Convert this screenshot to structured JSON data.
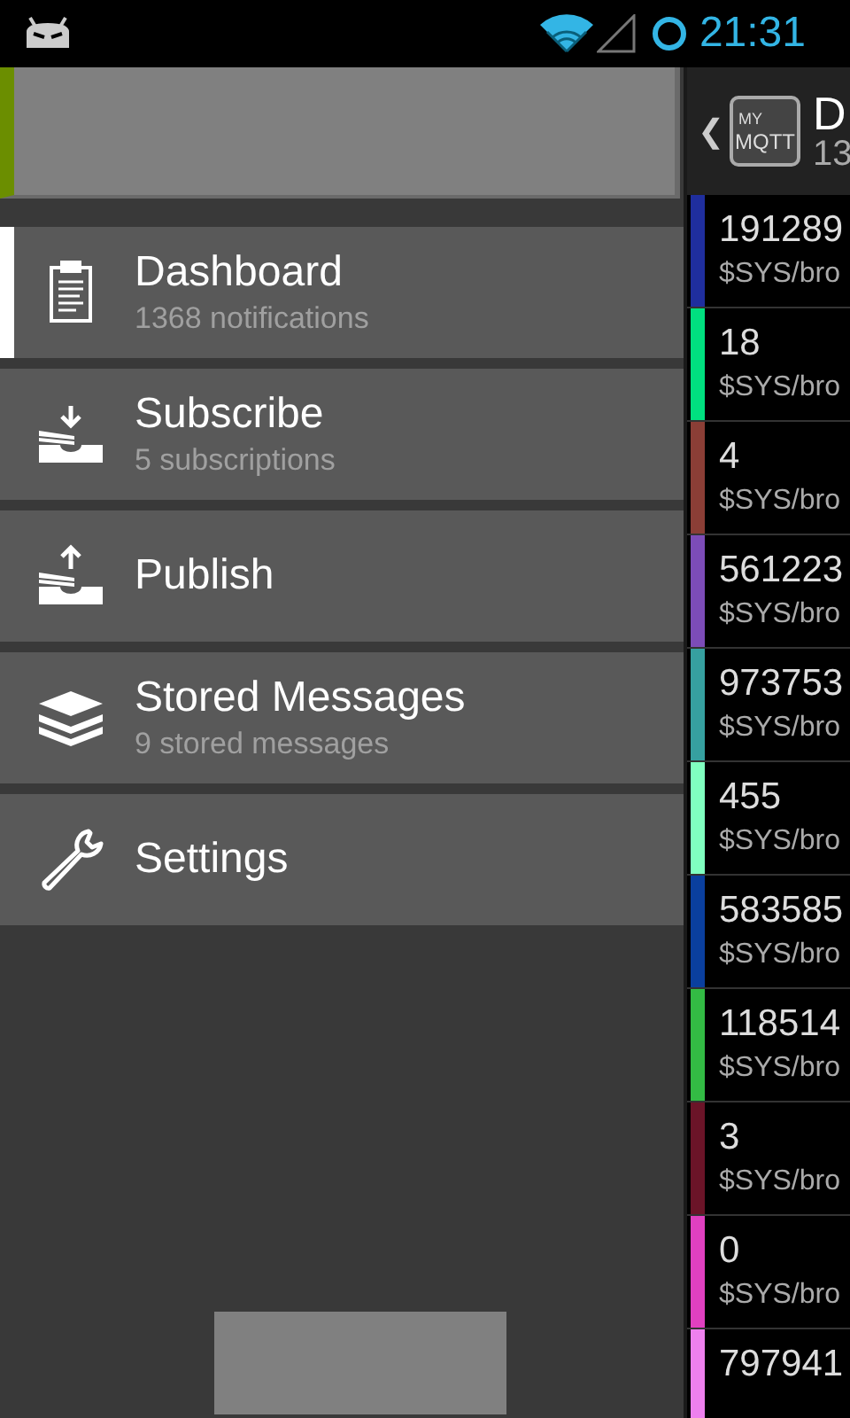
{
  "status_bar": {
    "time": "21:31"
  },
  "drawer": {
    "menu": [
      {
        "kind": "dashboard",
        "title": "Dashboard",
        "subtitle": "1368 notifications",
        "selected": true
      },
      {
        "kind": "subscribe",
        "title": "Subscribe",
        "subtitle": "5 subscriptions",
        "selected": false
      },
      {
        "kind": "publish",
        "title": "Publish",
        "selected": false
      },
      {
        "kind": "stored",
        "title": "Stored Messages",
        "subtitle": "9 stored messages",
        "selected": false
      },
      {
        "kind": "settings",
        "title": "Settings",
        "selected": false
      }
    ]
  },
  "action_bar": {
    "back": "❮",
    "logo": [
      "MY",
      "MQTT"
    ],
    "title": "D",
    "subtitle": "13"
  },
  "messages": [
    {
      "value": "191289",
      "topic": "$SYS/bro",
      "color": "#1f2e9e"
    },
    {
      "value": "18",
      "topic": "$SYS/bro",
      "color": "#00e080"
    },
    {
      "value": "4",
      "topic": "$SYS/bro",
      "color": "#8b3e36"
    },
    {
      "value": "561223",
      "topic": "$SYS/bro",
      "color": "#7c4cb8"
    },
    {
      "value": "973753",
      "topic": "$SYS/bro",
      "color": "#36a0a0"
    },
    {
      "value": "455",
      "topic": "$SYS/bro",
      "color": "#80ffc0"
    },
    {
      "value": "583585",
      "topic": "$SYS/bro",
      "color": "#0a3f9e"
    },
    {
      "value": "118514",
      "topic": "$SYS/bro",
      "color": "#33bb44"
    },
    {
      "value": "3",
      "topic": "$SYS/bro",
      "color": "#6b1428"
    },
    {
      "value": "0",
      "topic": "$SYS/bro",
      "color": "#e040c0"
    },
    {
      "value": "797941",
      "color": "#ee80ee"
    }
  ]
}
